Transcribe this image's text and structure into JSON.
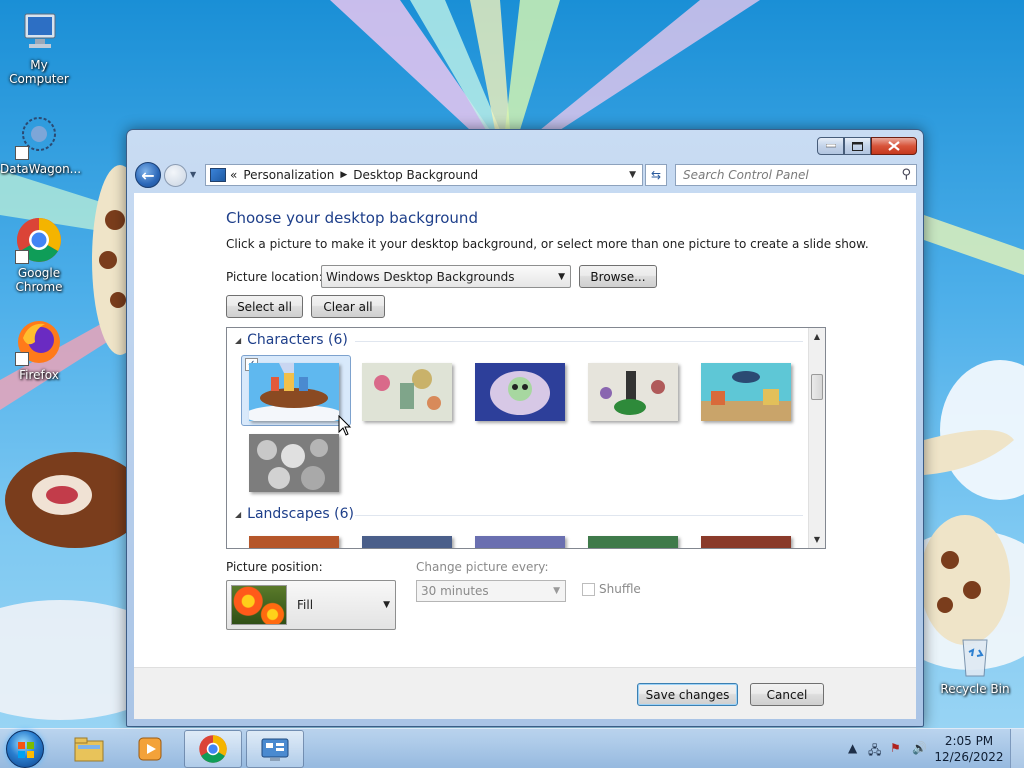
{
  "desktop": {
    "icons": [
      {
        "label": "My Computer"
      },
      {
        "label": "DataWagon..."
      },
      {
        "label": "Google Chrome"
      },
      {
        "label": "Firefox"
      },
      {
        "label": "Recycle Bin"
      }
    ]
  },
  "window": {
    "breadcrumb": [
      "Personalization",
      "Desktop Background"
    ],
    "search_placeholder": "Search Control Panel",
    "heading": "Choose your desktop background",
    "subtext": "Click a picture to make it your desktop background, or select more than one picture to create a slide show.",
    "picture_location_label": "Picture location:",
    "picture_location_value": "Windows Desktop Backgrounds",
    "browse_label": "Browse...",
    "select_all_label": "Select all",
    "clear_all_label": "Clear all",
    "groups": [
      {
        "title": "Characters (6)",
        "count": 6
      },
      {
        "title": "Landscapes (6)",
        "count": 6
      }
    ],
    "selected_thumbnail": "character-1",
    "picture_position_label": "Picture position:",
    "picture_position_value": "Fill",
    "change_every_label": "Change picture every:",
    "change_every_value": "30 minutes",
    "shuffle_label": "Shuffle",
    "shuffle_checked": false,
    "save_label": "Save changes",
    "cancel_label": "Cancel"
  },
  "taskbar": {
    "time": "2:05 PM",
    "date": "12/26/2022"
  },
  "colors": {
    "heading": "#1e3f8a",
    "desktop_sky": "#4fb0ea",
    "selection": "#d8e9fb"
  }
}
